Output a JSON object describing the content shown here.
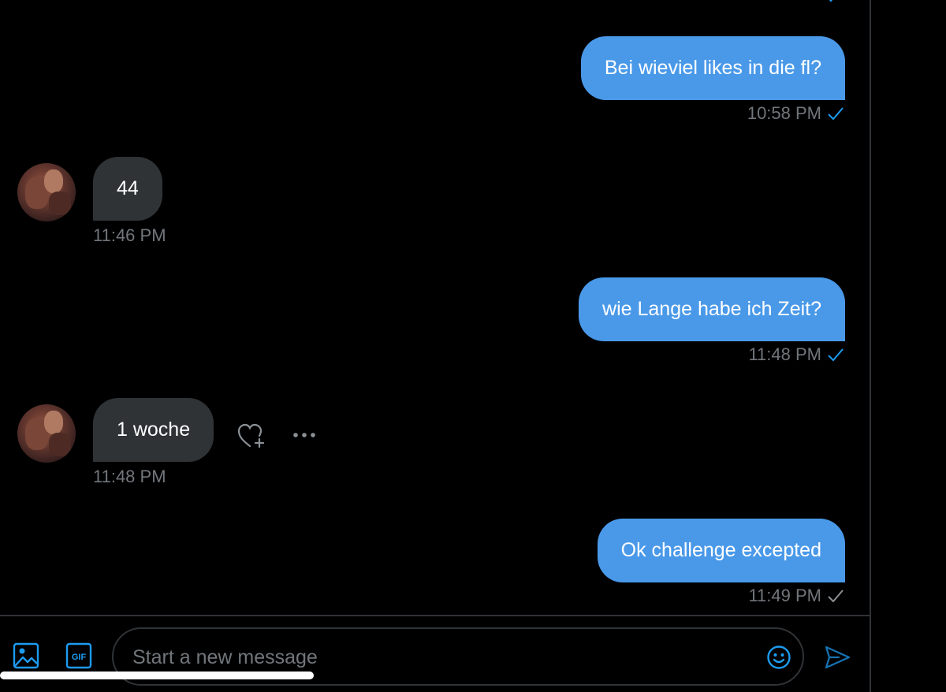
{
  "messages": [
    {
      "direction": "out",
      "text": "Bei wieviel likes in die fl?",
      "time": "10:58 PM",
      "status": "read"
    },
    {
      "direction": "in",
      "text": "44",
      "time": "11:46 PM"
    },
    {
      "direction": "out",
      "text": "wie Lange habe ich Zeit?",
      "time": "11:48 PM",
      "status": "read"
    },
    {
      "direction": "in",
      "text": "1 woche",
      "time": "11:48 PM"
    },
    {
      "direction": "out",
      "text": "Ok challenge excepted",
      "time": "11:49 PM",
      "status": "sent"
    }
  ],
  "composer": {
    "placeholder": "Start a new message",
    "icons": {
      "media": "image-icon",
      "gif": "gif-icon",
      "gif_text": "GIF",
      "emoji": "emoji-icon",
      "send": "send-icon"
    }
  },
  "message_actions": {
    "react": "heart-plus-icon",
    "more": "more-options-icon"
  },
  "colors": {
    "background": "#000000",
    "outgoing_bubble": "#4a99e9",
    "incoming_bubble": "#2f3336",
    "timestamp": "#71767b",
    "read_check": "#1d9bf0",
    "accent": "#1d9bf0"
  }
}
